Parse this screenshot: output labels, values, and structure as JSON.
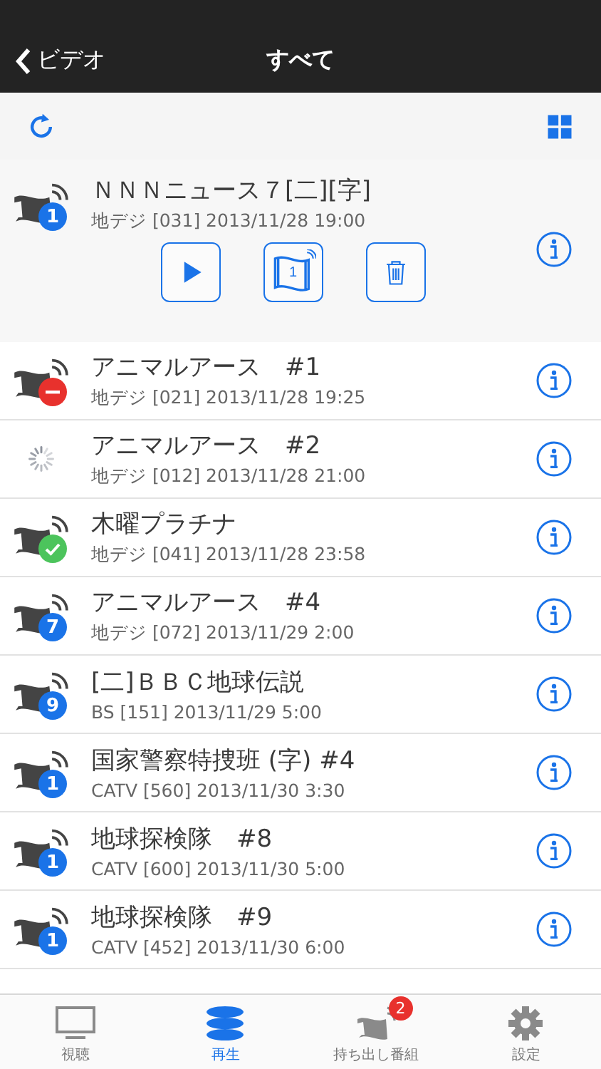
{
  "nav": {
    "back": "ビデオ",
    "title": "すべて"
  },
  "recordings": [
    {
      "title": "ＮＮＮニュース７[二][字]",
      "info": "地デジ [031] 2013/11/28 19:00",
      "status": {
        "kind": "count",
        "label": "1"
      },
      "expanded": true,
      "actions": [
        {
          "kind": "play"
        },
        {
          "kind": "transfer",
          "label": "1"
        },
        {
          "kind": "delete"
        }
      ]
    },
    {
      "title": "アニマルアース　#1",
      "info": "地デジ [021] 2013/11/28 19:25",
      "status": {
        "kind": "error"
      },
      "expanded": false
    },
    {
      "title": "アニマルアース　#2",
      "info": "地デジ [012] 2013/11/28 21:00",
      "status": {
        "kind": "loading"
      },
      "expanded": false
    },
    {
      "title": "木曜プラチナ",
      "info": "地デジ [041] 2013/11/28 23:58",
      "status": {
        "kind": "done"
      },
      "expanded": false
    },
    {
      "title": "アニマルアース　#4",
      "info": "地デジ [072] 2013/11/29 2:00",
      "status": {
        "kind": "count",
        "label": "7"
      },
      "expanded": false
    },
    {
      "title": "[二]ＢＢＣ地球伝説",
      "info": "BS [151] 2013/11/29 5:00",
      "status": {
        "kind": "count",
        "label": "9"
      },
      "expanded": false
    },
    {
      "title": "国家警察特捜班 (字) #4",
      "info": "CATV [560] 2013/11/30 3:30",
      "status": {
        "kind": "count",
        "label": "1"
      },
      "expanded": false
    },
    {
      "title": "地球探検隊　#8",
      "info": "CATV [600] 2013/11/30 5:00",
      "status": {
        "kind": "count",
        "label": "1"
      },
      "expanded": false
    },
    {
      "title": "地球探検隊　#9",
      "info": "CATV [452] 2013/11/30 6:00",
      "status": {
        "kind": "count",
        "label": "1"
      },
      "expanded": false
    }
  ],
  "tabs": [
    {
      "kind": "tv",
      "label": "視聴",
      "selected": false
    },
    {
      "kind": "play",
      "label": "再生",
      "selected": true
    },
    {
      "kind": "carry",
      "label": "持ち出し番組",
      "selected": false,
      "badge": "2"
    },
    {
      "kind": "settings",
      "label": "設定",
      "selected": false
    }
  ]
}
